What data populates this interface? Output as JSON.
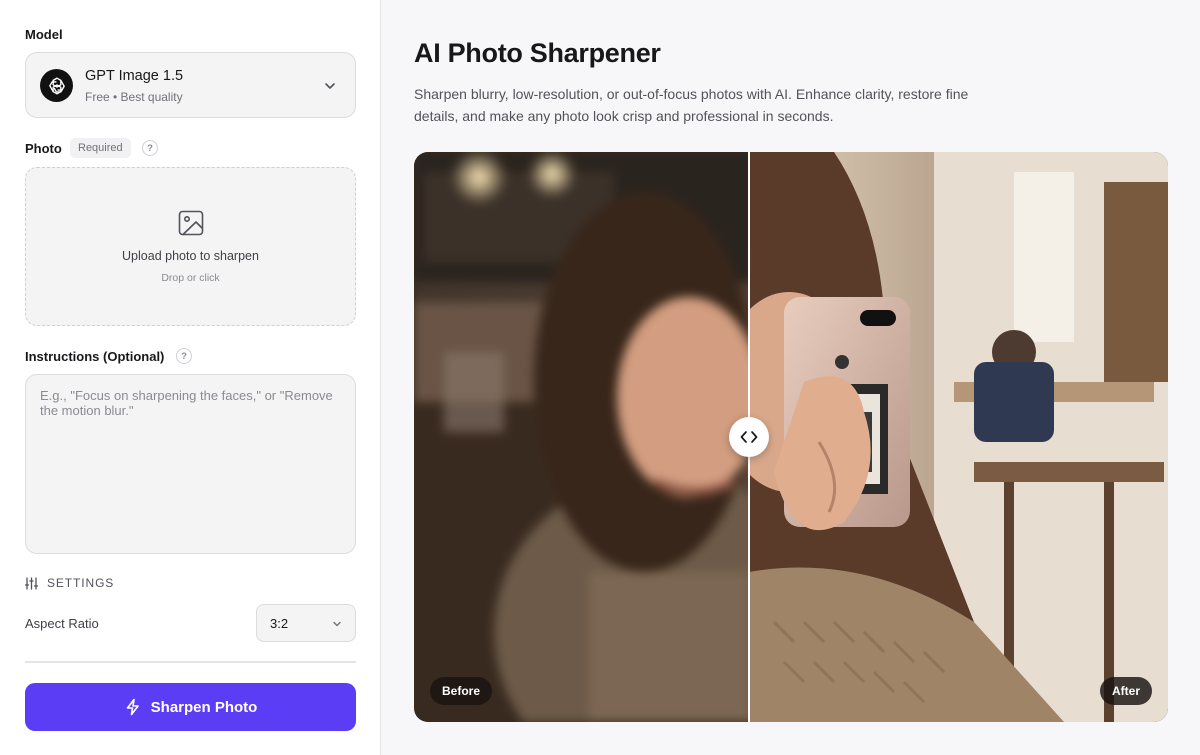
{
  "sidebar": {
    "model_label": "Model",
    "model": {
      "name": "GPT Image 1.5",
      "subtitle": "Free • Best quality",
      "icon": "openai-logo-icon"
    },
    "photo_label": "Photo",
    "required_badge": "Required",
    "help_glyph": "?",
    "upload": {
      "title": "Upload photo to sharpen",
      "subtitle": "Drop or click",
      "icon": "image-icon"
    },
    "instructions_label": "Instructions (Optional)",
    "instructions_placeholder": "E.g., \"Focus on sharpening the faces,\" or \"Remove the motion blur.\"",
    "instructions_value": "",
    "settings_label": "SETTINGS",
    "aspect_ratio_label": "Aspect Ratio",
    "aspect_ratio_value": "3:2",
    "cta_label": "Sharpen Photo"
  },
  "main": {
    "title": "AI Photo Sharpener",
    "description": "Sharpen blurry, low-resolution, or out-of-focus photos with AI. Enhance clarity, restore fine details, and make any photo look crisp and professional in seconds.",
    "compare": {
      "before_label": "Before",
      "after_label": "After",
      "split_fraction": 0.445
    }
  },
  "colors": {
    "accent": "#5b3df5",
    "panel_bg": "#f7f7f9",
    "field_bg": "#f4f4f5"
  }
}
